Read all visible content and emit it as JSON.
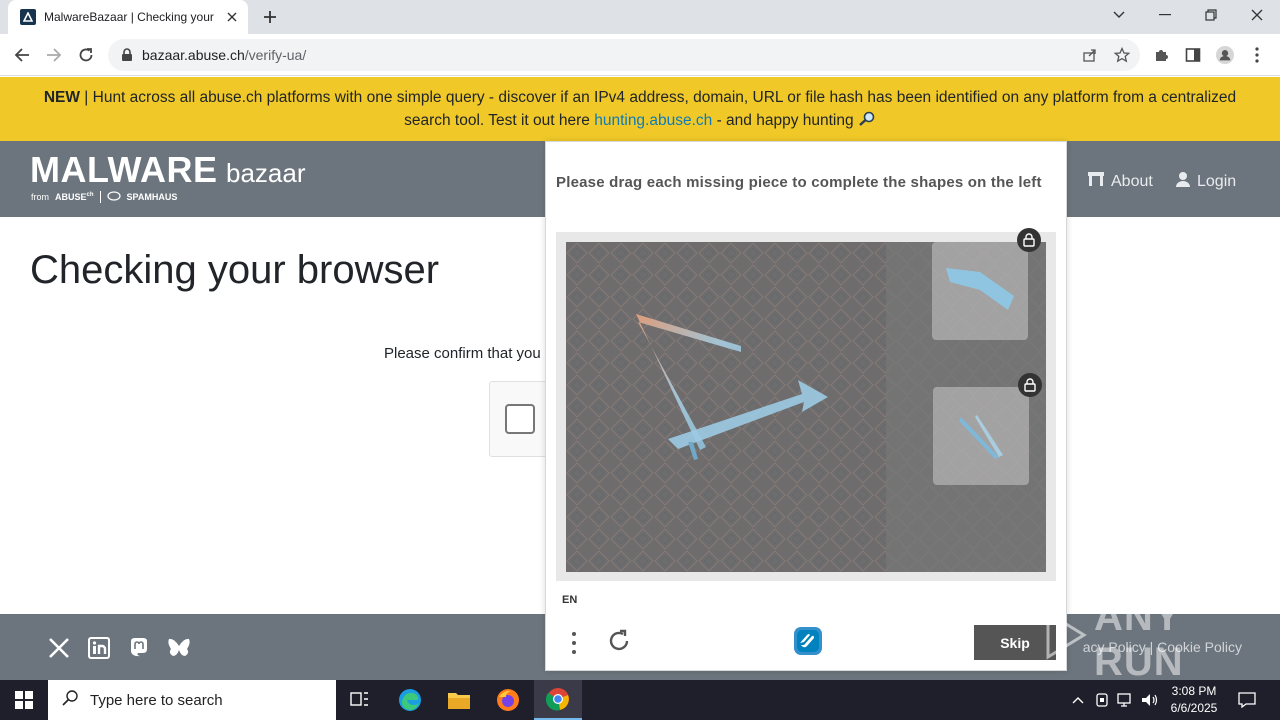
{
  "browser": {
    "tab_title": "MalwareBazaar | Checking your bro",
    "url_host": "bazaar.abuse.ch",
    "url_path": "/verify-ua/"
  },
  "banner": {
    "new_label": "NEW",
    "text_before_link": " | Hunt across all abuse.ch platforms with one simple query - discover if an IPv4 address, domain, URL or file hash has been identified on any platform from a centralized search tool. Test it out here ",
    "link_text": "hunting.abuse.ch",
    "text_after_link": " - and happy hunting "
  },
  "site": {
    "logo_main": "MALWARE",
    "logo_sub": "bazaar",
    "logo_from": "from",
    "logo_abuse": "ABUSE",
    "logo_abuse_ch": "ch",
    "logo_spamhaus": "SPAMHAUS",
    "nav": [
      {
        "label": "About"
      },
      {
        "label": "Login"
      }
    ],
    "page_title": "Checking your browser",
    "confirm_text": "Please confirm that you"
  },
  "footer": {
    "links_text": "acy Policy  |  Cookie Policy"
  },
  "challenge": {
    "prompt": "Please drag each missing piece to complete the shapes on the left",
    "language": "EN",
    "skip_label": "Skip"
  },
  "watermark": {
    "text": "ANY RUN"
  },
  "taskbar": {
    "search_placeholder": "Type here to search",
    "time": "3:08 PM",
    "date": "6/6/2025"
  },
  "colors": {
    "banner_bg": "#f0c929",
    "header_bg": "#6c757d",
    "link": "#0e7bb8",
    "skip_bg": "#555555",
    "taskbar_bg": "#1f1f2b"
  }
}
